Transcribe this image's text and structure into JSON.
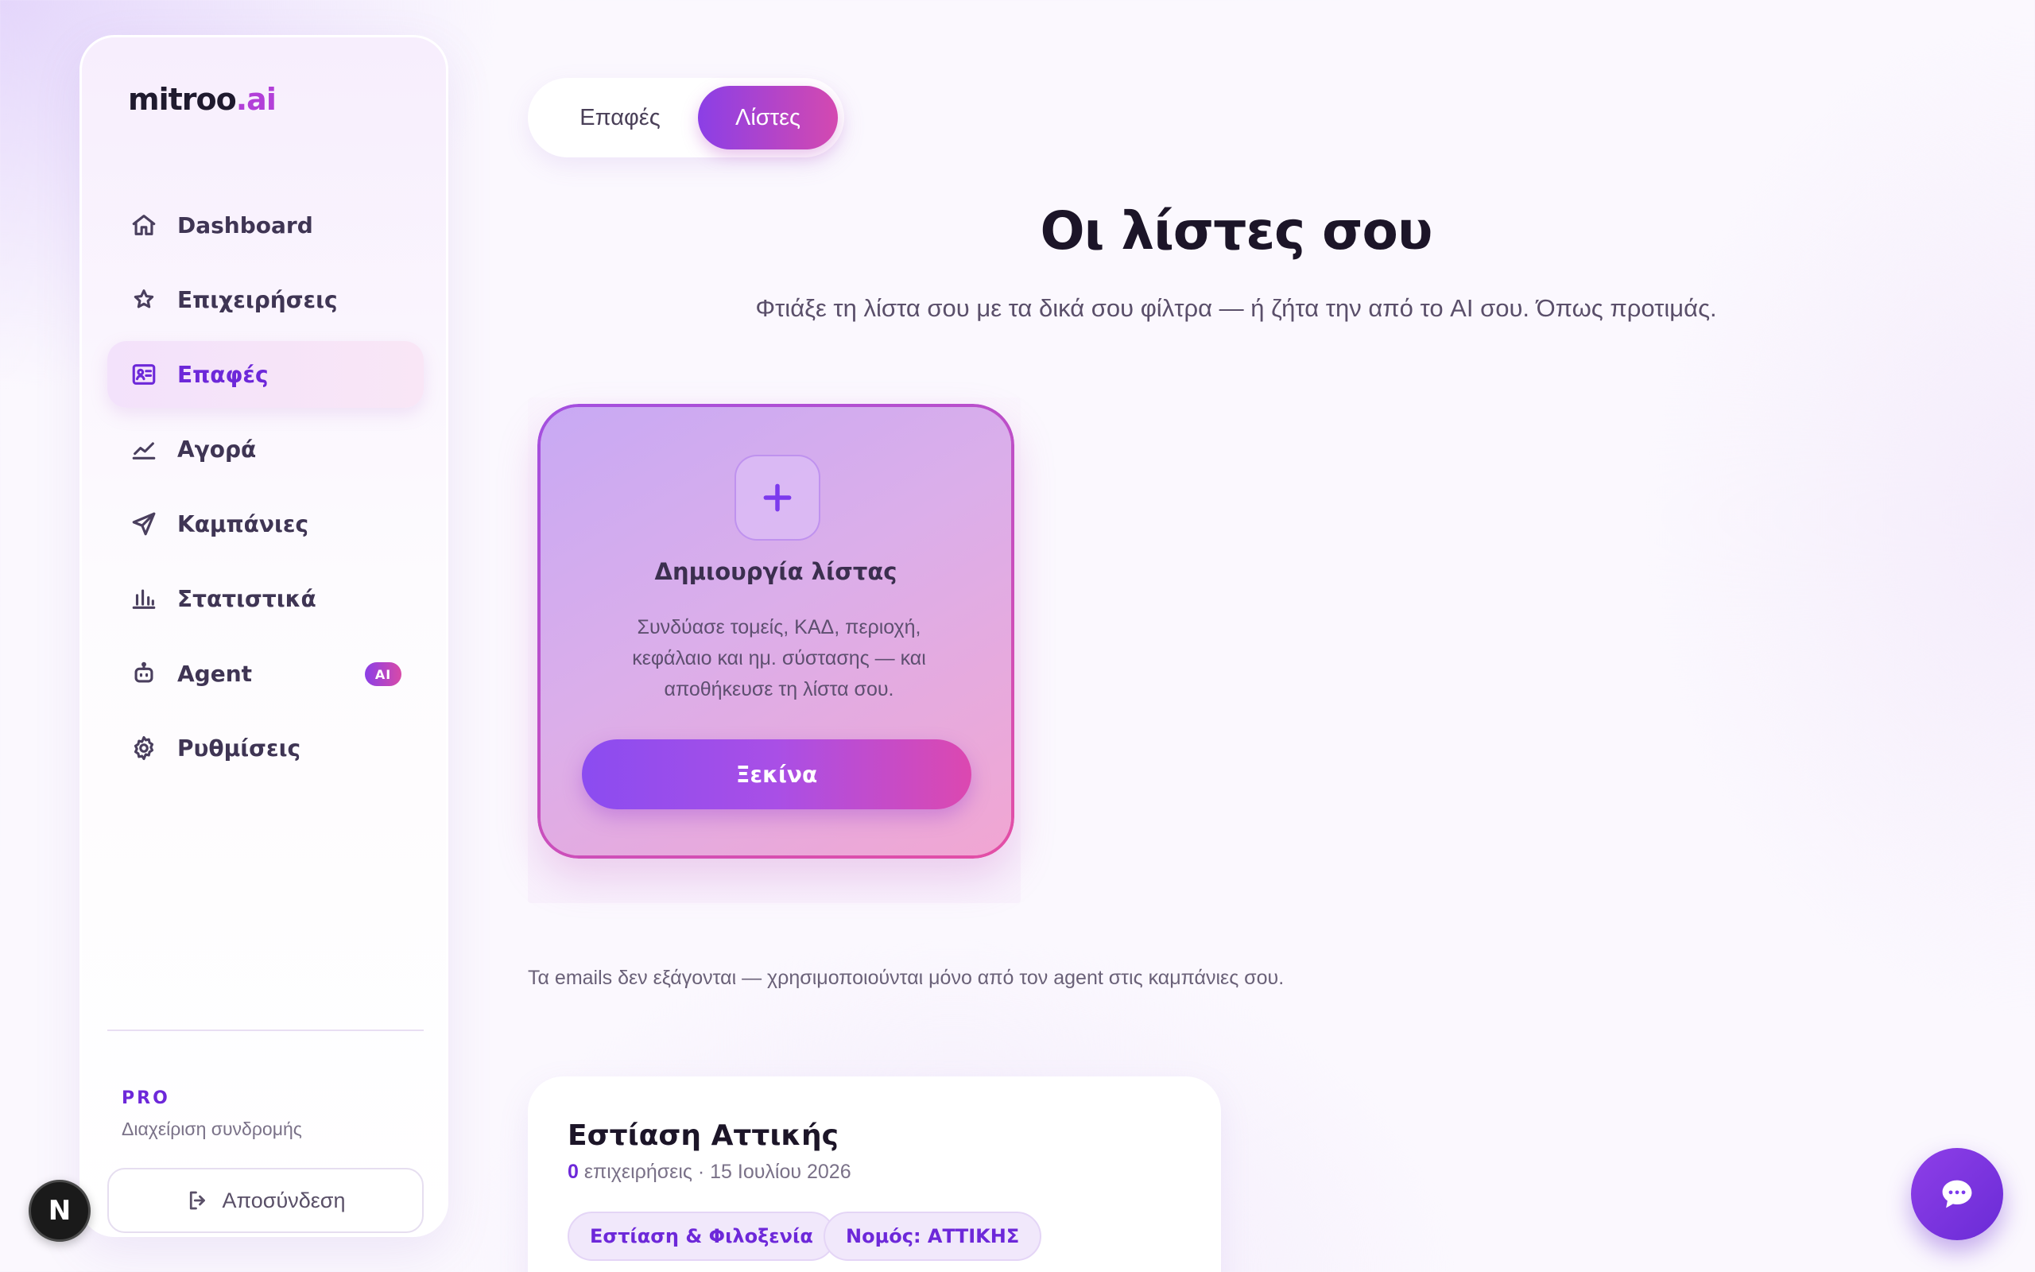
{
  "brand": {
    "name": "mitroo",
    "suffix": ".ai"
  },
  "sidebar": {
    "items": [
      {
        "label": "Dashboard",
        "icon": "home-icon"
      },
      {
        "label": "Επιχειρήσεις",
        "icon": "star-icon"
      },
      {
        "label": "Επαφές",
        "icon": "contact-card-icon",
        "active": true
      },
      {
        "label": "Αγορά",
        "icon": "trend-chart-icon"
      },
      {
        "label": "Καμπάνιες",
        "icon": "send-icon"
      },
      {
        "label": "Στατιστικά",
        "icon": "bar-chart-icon"
      },
      {
        "label": "Agent",
        "icon": "robot-icon",
        "badge": "AI"
      },
      {
        "label": "Ρυθμίσεις",
        "icon": "gear-icon"
      }
    ],
    "plan": "PRO",
    "plan_link": "Διαχείριση συνδρομής",
    "logout": "Αποσύνδεση"
  },
  "tabs": [
    {
      "label": "Επαφές",
      "active": false
    },
    {
      "label": "Λίστες",
      "active": true
    }
  ],
  "header": {
    "title": "Οι λίστες σου",
    "subtitle": "Φτιάξε τη λίστα σου με τα δικά σου φίλτρα — ή ζήτα την από το AI σου. Όπως προτιμάς."
  },
  "create_card": {
    "title": "Δημιουργία λίστας",
    "description": "Συνδύασε τομείς, ΚΑΔ, περιοχή, κεφάλαιο και ημ. σύστασης — και αποθήκευσε τη λίστα σου.",
    "button": "Ξεκίνα"
  },
  "note": "Τα emails δεν εξάγονται — χρησιμοποιούνται μόνο από τον agent στις καμπάνιες σου.",
  "lists": [
    {
      "name": "Εστίαση Αττικής",
      "count": "0",
      "meta": " επιχειρήσεις · 15 Ιουλίου 2026",
      "tags": [
        "Εστίαση & Φιλοξενία",
        "Νομός: ΑΤΤΙΚΗΣ"
      ]
    }
  ],
  "dev_badge": "N",
  "colors": {
    "accent": "#6d28d9",
    "gradient_start": "#8b3fe6",
    "gradient_end": "#d449b0"
  }
}
